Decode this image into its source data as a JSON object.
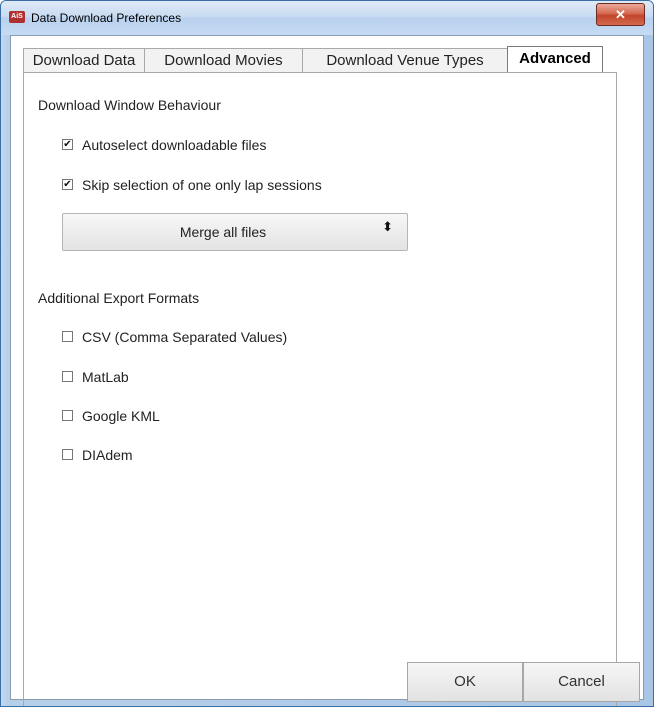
{
  "window": {
    "title": "Data Download Preferences",
    "app_icon_label": "AiS",
    "close_glyph": "✕"
  },
  "tabs": [
    {
      "label": "Download Data",
      "active": false
    },
    {
      "label": "Download Movies",
      "active": false
    },
    {
      "label": "Download Venue Types",
      "active": false
    },
    {
      "label": "Advanced",
      "active": true
    }
  ],
  "download_window": {
    "title": "Download Window Behaviour",
    "options": [
      {
        "label": "Autoselect downloadable files",
        "checked": true
      },
      {
        "label": "Skip selection of one only lap sessions",
        "checked": true
      }
    ],
    "merge_select": {
      "value": "Merge all files",
      "arrows": "⬍"
    }
  },
  "export_formats": {
    "title": "Additional Export Formats",
    "options": [
      {
        "label": "CSV (Comma Separated Values)",
        "checked": false
      },
      {
        "label": "MatLab",
        "checked": false
      },
      {
        "label": "Google KML",
        "checked": false
      },
      {
        "label": "DIAdem",
        "checked": false
      }
    ]
  },
  "buttons": {
    "ok": "OK",
    "cancel": "Cancel"
  },
  "check_mark": "✔"
}
